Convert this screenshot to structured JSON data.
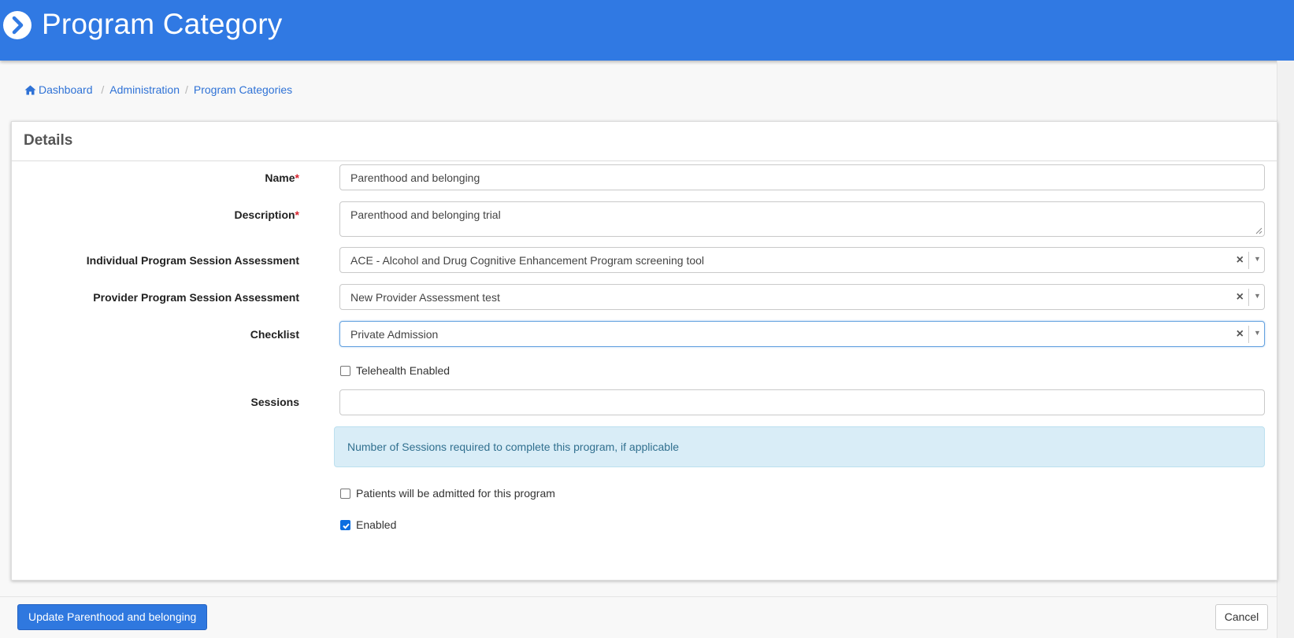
{
  "header": {
    "title": "Program Category",
    "icon": "chevron-right-circle-icon",
    "color": "#3079e3"
  },
  "breadcrumb": [
    {
      "label": "Dashboard",
      "icon": "home-icon"
    },
    {
      "label": "Administration"
    },
    {
      "label": "Program Categories"
    }
  ],
  "panel": {
    "title": "Details"
  },
  "form": {
    "name": {
      "label": "Name",
      "required": "*",
      "value": "Parenthood and belonging"
    },
    "description": {
      "label": "Description",
      "required": "*",
      "value": "Parenthood and belonging trial"
    },
    "individual_assessment": {
      "label": "Individual Program Session Assessment",
      "value": "ACE - Alcohol and Drug Cognitive Enhancement Program screening tool"
    },
    "provider_assessment": {
      "label": "Provider Program Session Assessment",
      "value": "New Provider Assessment test"
    },
    "checklist": {
      "label": "Checklist",
      "value": "Private Admission"
    },
    "telehealth": {
      "label": "Telehealth Enabled",
      "checked": false
    },
    "sessions": {
      "label": "Sessions",
      "value": "",
      "help": "Number of Sessions required to complete this program, if applicable"
    },
    "admitted": {
      "label": "Patients will be admitted for this program",
      "checked": false
    },
    "enabled": {
      "label": "Enabled",
      "checked": true
    }
  },
  "footer": {
    "update_label": "Update Parenthood and belonging",
    "cancel_label": "Cancel"
  },
  "clear_glyph": "×",
  "dropdown_glyph": "▼"
}
